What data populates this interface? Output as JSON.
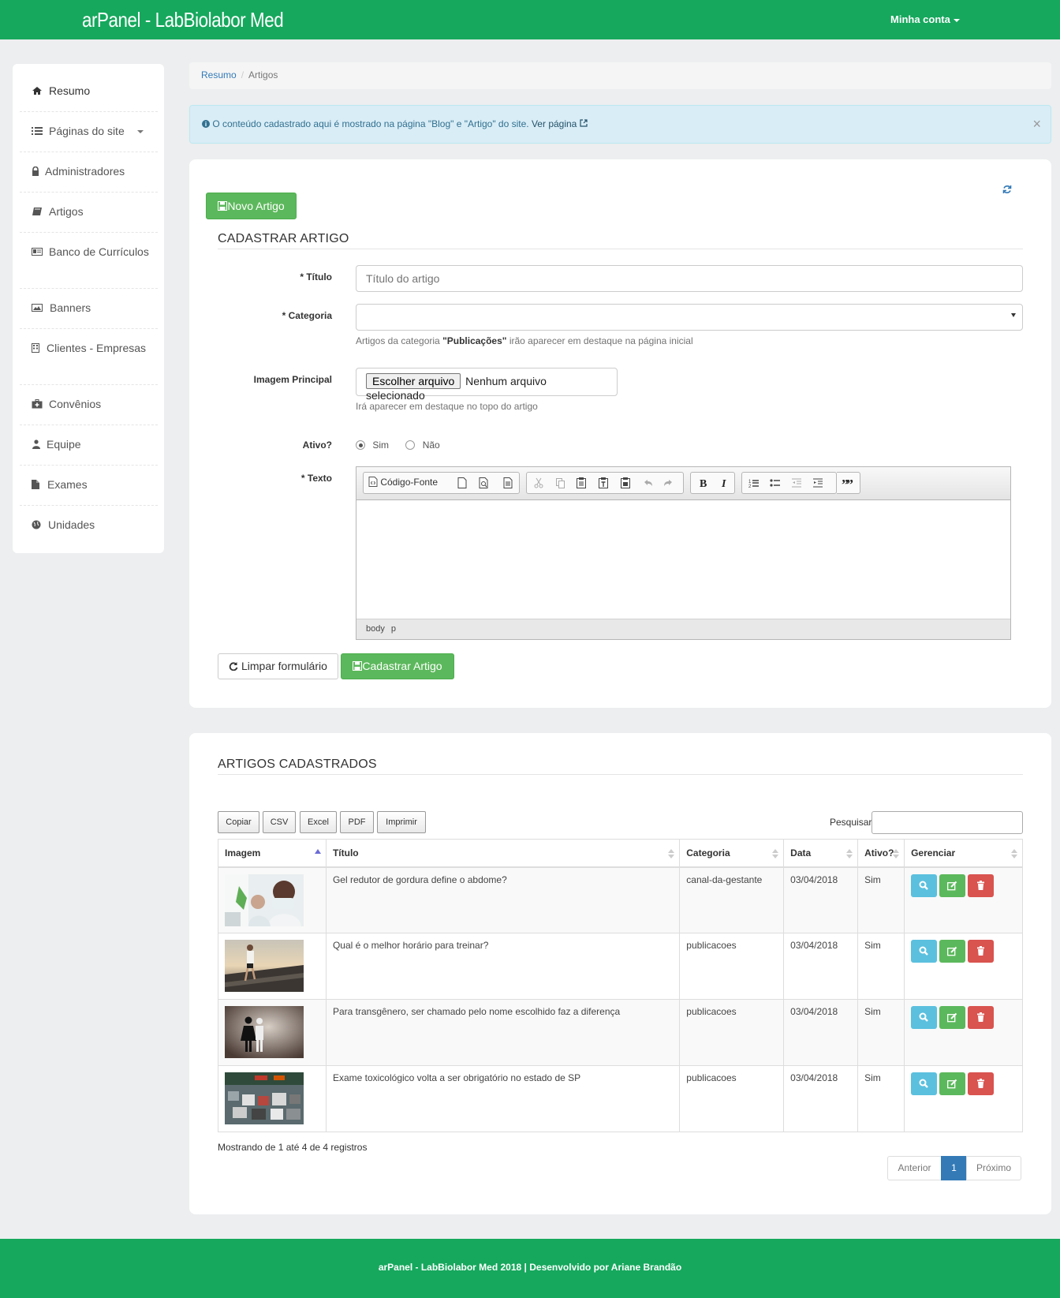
{
  "header": {
    "brand": "arPanel - LabBiolabor Med",
    "account_label": "Minha conta"
  },
  "sidebar": {
    "items": [
      {
        "label": "Resumo",
        "icon": "home-icon"
      },
      {
        "label": "Páginas do site",
        "icon": "list-icon"
      },
      {
        "label": "Administradores",
        "icon": "lock-icon"
      },
      {
        "label": "Artigos",
        "icon": "book-icon"
      },
      {
        "label": "Banco de Currículos",
        "icon": "id-card-icon"
      },
      {
        "label": "Banners",
        "icon": "image-icon"
      },
      {
        "label": "Clientes - Empresas",
        "icon": "building-icon"
      },
      {
        "label": "Convênios",
        "icon": "medkit-icon"
      },
      {
        "label": "Equipe",
        "icon": "user-md-icon"
      },
      {
        "label": "Exames",
        "icon": "file-icon"
      },
      {
        "label": "Unidades",
        "icon": "globe-icon"
      }
    ]
  },
  "breadcrumb": {
    "home": "Resumo",
    "current": "Artigos"
  },
  "alert": {
    "text": " O conteúdo cadastrado aqui é mostrado na página \"Blog\" e \"Artigo\" do site. ",
    "link": "Ver página",
    "close": "×"
  },
  "form": {
    "new_button": "Novo Artigo",
    "title": "CADASTRAR ARTIGO",
    "titulo_label": "* Título",
    "titulo_placeholder": "Título do artigo",
    "categoria_label": "* Categoria",
    "categoria_value": "",
    "categoria_help_pre": "Artigos da categoria ",
    "categoria_help_bold": "\"Publicações\"",
    "categoria_help_post": " irão aparecer em destaque na página inicial",
    "imagem_label": "Imagem Principal",
    "file_button": "Escolher arquivo",
    "file_status": "Nenhum arquivo selecionado",
    "imagem_help": "Irá aparecer em destaque no topo do artigo",
    "ativo_label": "Ativo?",
    "ativo_sim": "Sim",
    "ativo_nao": "Não",
    "ativo_value": "Sim",
    "texto_label": "* Texto",
    "editor": {
      "source_button": "Código-Fonte",
      "status_path": [
        "body",
        "p"
      ]
    },
    "clear_button": "Limpar formulário",
    "submit_button": "Cadastrar Artigo"
  },
  "list": {
    "title": "ARTIGOS CADASTRADOS",
    "export_buttons": [
      "Copiar",
      "CSV",
      "Excel",
      "PDF",
      "Imprimir"
    ],
    "search_label": "Pesquisar",
    "search_value": "",
    "columns": [
      "Imagem",
      "Título",
      "Categoria",
      "Data",
      "Ativo?",
      "Gerenciar"
    ],
    "rows": [
      {
        "titulo": "Gel redutor de gordura define o abdome?",
        "categoria": "canal-da-gestante",
        "data": "03/04/2018",
        "ativo": "Sim"
      },
      {
        "titulo": "Qual é o melhor horário para treinar?",
        "categoria": "publicacoes",
        "data": "03/04/2018",
        "ativo": "Sim"
      },
      {
        "titulo": "Para transgênero, ser chamado pelo nome escolhido faz a diferença",
        "categoria": "publicacoes",
        "data": "03/04/2018",
        "ativo": "Sim"
      },
      {
        "titulo": "Exame toxicológico volta a ser obrigatório no estado de SP",
        "categoria": "publicacoes",
        "data": "03/04/2018",
        "ativo": "Sim"
      }
    ],
    "info": "Mostrando de 1 até 4 de 4 registros",
    "pagination": {
      "prev": "Anterior",
      "page": "1",
      "next": "Próximo"
    }
  },
  "footer": {
    "text": "arPanel - LabBiolabor Med 2018 | Desenvolvido por Ariane Brandão"
  },
  "colors": {
    "brand_green": "#16a85d",
    "btn_green": "#5cb85c",
    "info": "#5bc0de",
    "danger": "#d9534f",
    "primary": "#337ab7"
  }
}
